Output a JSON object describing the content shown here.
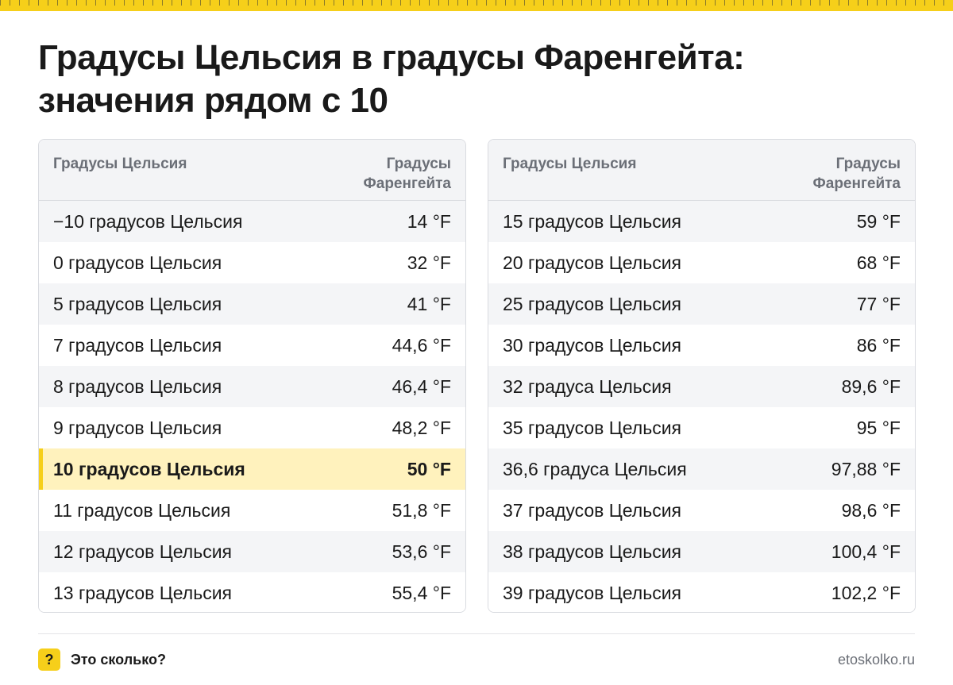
{
  "title": {
    "line1": "Градусы Цельсия в градусы Фаренгейта:",
    "line2": "значения рядом с 10"
  },
  "colors": {
    "accent": "#f6cf1a",
    "highlight_row": "#fff2bd"
  },
  "tables": [
    {
      "header": {
        "celsius": "Градусы Цельсия",
        "fahrenheit": "Градусы Фаренгейта"
      },
      "rows": [
        {
          "c": "−10 градусов Цельсия",
          "f": "14 °F"
        },
        {
          "c": "0 градусов Цельсия",
          "f": "32 °F"
        },
        {
          "c": "5 градусов Цельсия",
          "f": "41 °F"
        },
        {
          "c": "7 градусов Цельсия",
          "f": "44,6 °F"
        },
        {
          "c": "8 градусов Цельсия",
          "f": "46,4 °F"
        },
        {
          "c": "9 градусов Цельсия",
          "f": "48,2 °F"
        },
        {
          "c": "10 градусов Цельсия",
          "f": "50 °F",
          "highlight": true
        },
        {
          "c": "11 градусов Цельсия",
          "f": "51,8 °F"
        },
        {
          "c": "12 градусов Цельсия",
          "f": "53,6 °F"
        },
        {
          "c": "13 градусов Цельсия",
          "f": "55,4 °F"
        }
      ]
    },
    {
      "header": {
        "celsius": "Градусы Цельсия",
        "fahrenheit": "Градусы Фаренгейта"
      },
      "rows": [
        {
          "c": "15 градусов Цельсия",
          "f": "59 °F"
        },
        {
          "c": "20 градусов Цельсия",
          "f": "68 °F"
        },
        {
          "c": "25 градусов Цельсия",
          "f": "77 °F"
        },
        {
          "c": "30 градусов Цельсия",
          "f": "86 °F"
        },
        {
          "c": "32 градуса Цельсия",
          "f": "89,6 °F"
        },
        {
          "c": "35 градусов Цельсия",
          "f": "95 °F"
        },
        {
          "c": "36,6 градуса Цельсия",
          "f": "97,88 °F"
        },
        {
          "c": "37 градусов Цельсия",
          "f": "98,6 °F"
        },
        {
          "c": "38 градусов Цельсия",
          "f": "100,4 °F"
        },
        {
          "c": "39 градусов Цельсия",
          "f": "102,2 °F"
        }
      ]
    }
  ],
  "footer": {
    "badge": "?",
    "brand": "Это сколько?",
    "site": "etoskolko.ru"
  }
}
